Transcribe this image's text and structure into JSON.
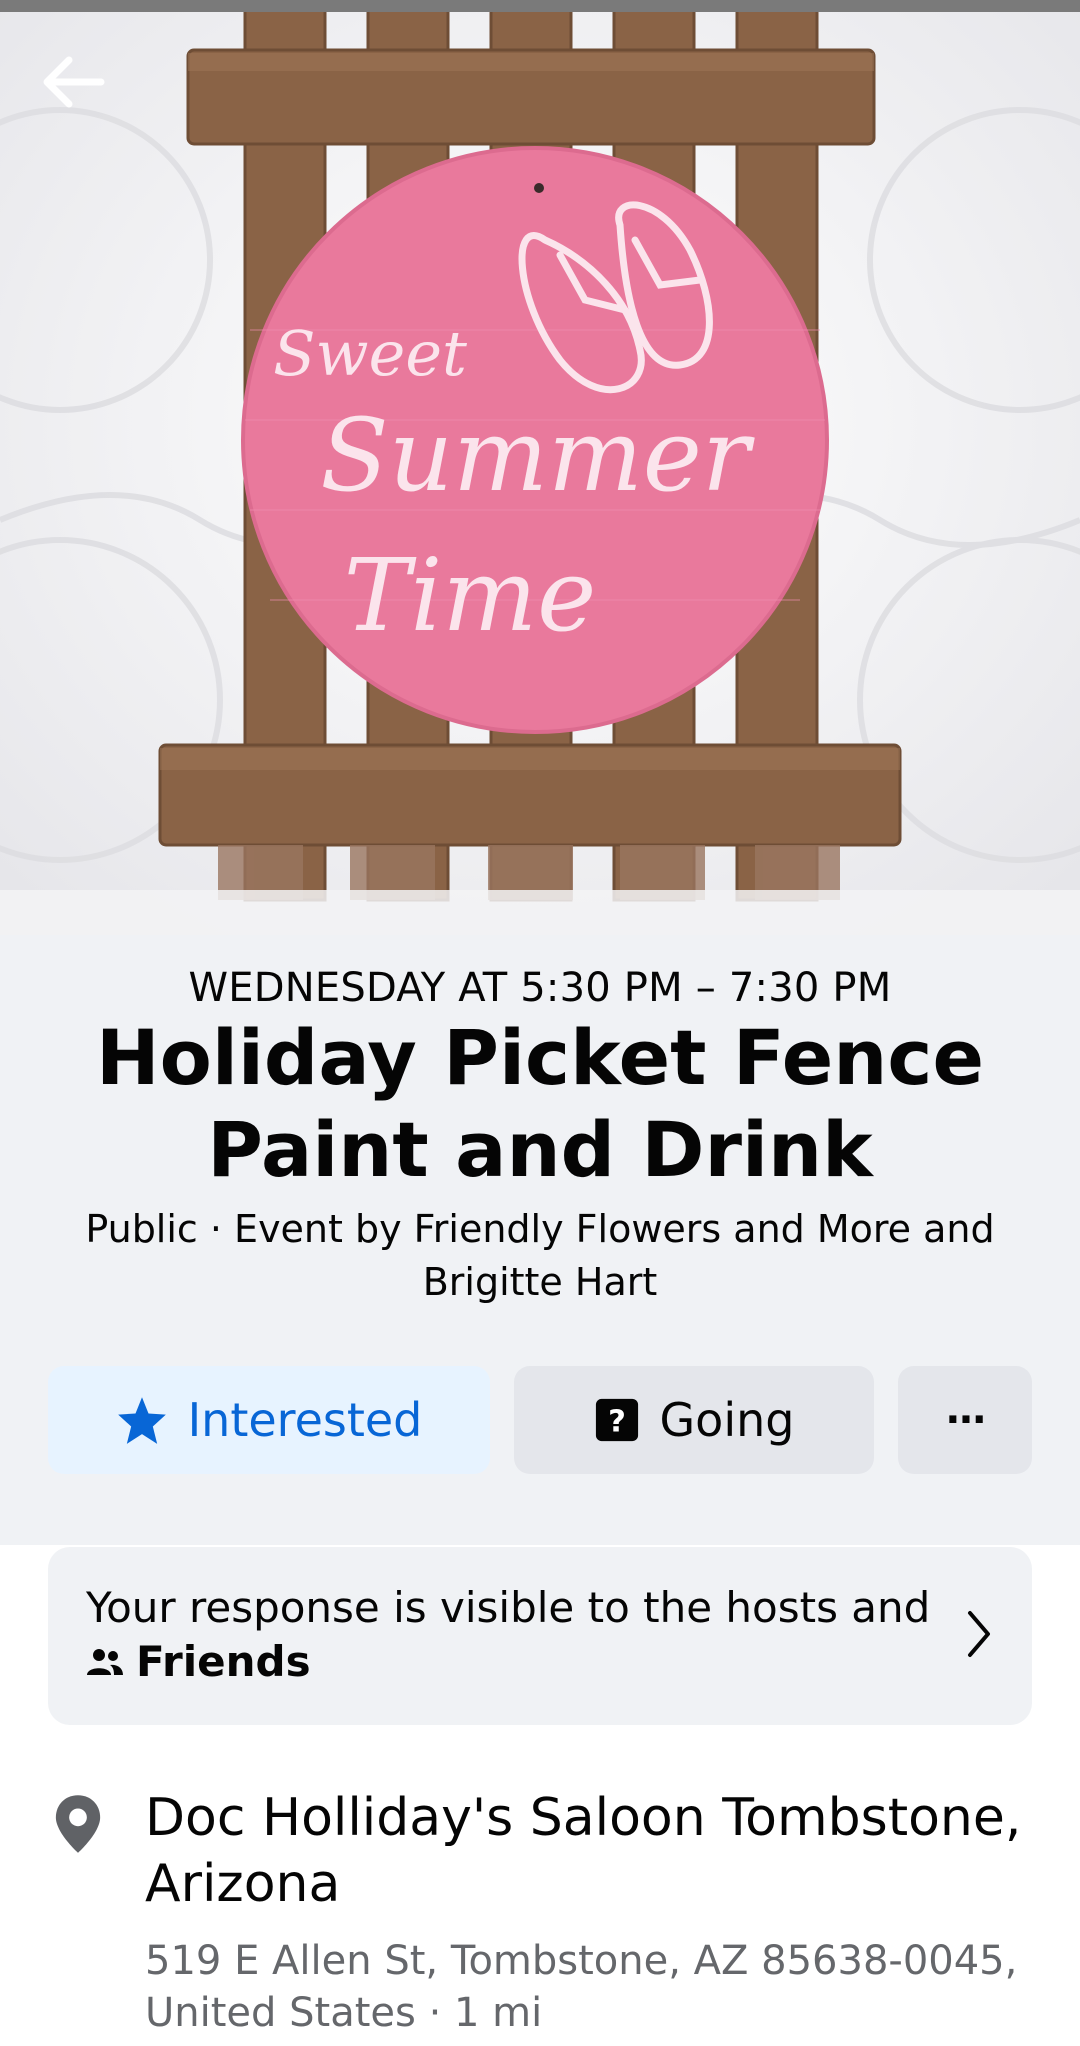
{
  "cover": {
    "sign_line1": "Sweet",
    "sign_line2": "Summer",
    "sign_line3": "Time",
    "sign_color": "#e9799c",
    "wood_color": "#8a6346"
  },
  "event": {
    "date_time": "WEDNESDAY AT 5:30 PM – 7:30 PM",
    "title": "Holiday Picket Fence Paint and Drink",
    "subtitle": "Public · Event by Friendly Flowers and More and Brigitte Hart"
  },
  "actions": {
    "interested_label": "Interested",
    "interested_icon": "star-icon",
    "going_label": "Going",
    "going_icon": "question-box-icon",
    "more_label": "···"
  },
  "response": {
    "text": "Your response is visible to the hosts and",
    "audience": "Friends",
    "audience_icon": "friends-icon"
  },
  "location": {
    "venue": "Doc Holliday's Saloon Tombstone, Arizona",
    "address": "519 E Allen St, Tombstone, AZ 85638-0045, United States · 1 mi",
    "icon": "location-pin-icon"
  },
  "colors": {
    "accent": "#0866d6",
    "accent_bg": "#e7f3ff",
    "button_gray": "#e4e6eb",
    "header_bg": "#f0f2f5",
    "secondary_text": "#65676b"
  }
}
